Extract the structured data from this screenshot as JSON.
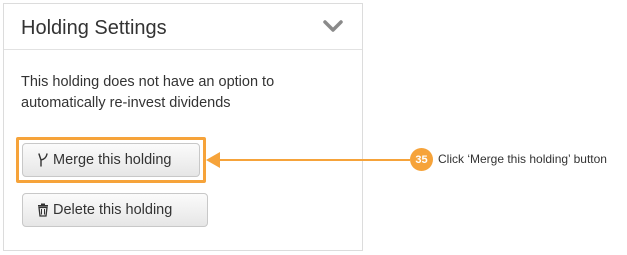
{
  "panel": {
    "title": "Holding Settings",
    "description": "This holding does not have an option to automatically re-invest dividends",
    "merge_label": "Merge this holding",
    "delete_label": "Delete this holding",
    "merge_icon": "merge-icon",
    "delete_icon": "trash-icon",
    "collapse_icon": "chevron-down-icon"
  },
  "annotation": {
    "step_number": "35",
    "instruction": "Click ‘Merge this holding’ button",
    "accent_color": "#f6a33a"
  }
}
